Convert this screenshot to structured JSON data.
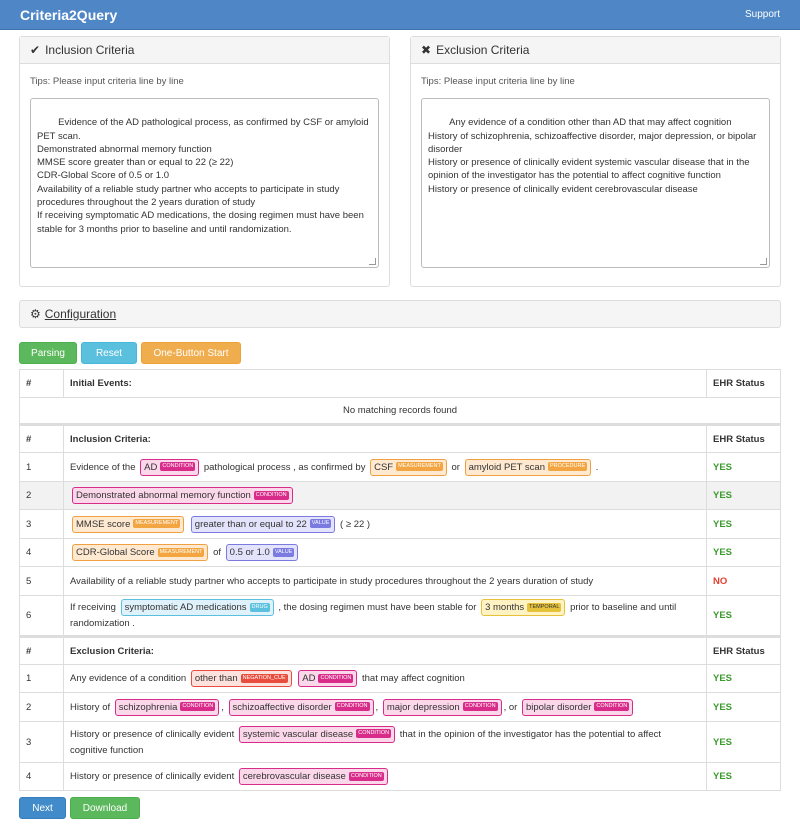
{
  "nav": {
    "brand": "Criteria2Query",
    "support": "Support"
  },
  "inclusion_panel": {
    "title": "Inclusion Criteria",
    "tips": "Tips: Please input criteria line by line",
    "text": "Evidence of the AD pathological process, as confirmed by CSF or amyloid PET scan.\nDemonstrated abnormal memory function\nMMSE score greater than or equal to 22 (≥ 22)\nCDR-Global Score of 0.5 or 1.0\nAvailability of a reliable study partner who accepts to participate in study procedures throughout the 2 years duration of study\nIf receiving symptomatic AD medications, the dosing regimen must have been stable for 3 months prior to baseline and until randomization."
  },
  "exclusion_panel": {
    "title": "Exclusion Criteria",
    "tips": "Tips: Please input criteria line by line",
    "text": "Any evidence of a condition other than AD that may affect cognition\nHistory of schizophrenia, schizoaffective disorder, major depression, or bipolar disorder\nHistory or presence of clinically evident systemic vascular disease that in the opinion of the investigator has the potential to affect cognitive function\nHistory or presence of clinically evident cerebrovascular disease"
  },
  "config": {
    "label": "Configuration"
  },
  "buttons": {
    "parsing": "Parsing",
    "reset": "Reset",
    "one_button": "One-Button Start",
    "next": "Next",
    "download": "Download"
  },
  "tags": {
    "condition": "CONDITION",
    "measurement": "MEASUREMENT",
    "procedure": "PROCEDURE",
    "value": "VALUE",
    "drug": "DRUG",
    "temporal": "TEMPORAL",
    "negation": "NEGATION_CUE"
  },
  "table": {
    "hash": "#",
    "ehr": "EHR Status",
    "initial_header": "Initial Events:",
    "no_records": "No matching records found",
    "inclusion_header": "Inclusion Criteria:",
    "exclusion_header": "Exclusion Criteria:",
    "inc": [
      {
        "n": "1",
        "status": "YES",
        "parts": [
          "Evidence of the",
          "AD",
          "pathological process , as confirmed by",
          "CSF",
          "or",
          "amyloid PET scan",
          "."
        ]
      },
      {
        "n": "2",
        "status": "YES",
        "parts": [
          "Demonstrated abnormal memory function"
        ]
      },
      {
        "n": "3",
        "status": "YES",
        "parts": [
          "MMSE score",
          "greater than or equal to 22",
          "( ≥ 22 )"
        ]
      },
      {
        "n": "4",
        "status": "YES",
        "parts": [
          "CDR-Global Score",
          "of",
          "0.5 or 1.0"
        ]
      },
      {
        "n": "5",
        "status": "NO",
        "parts": [
          "Availability of a reliable study partner who accepts to participate in study procedures throughout the 2 years duration of study"
        ]
      },
      {
        "n": "6",
        "status": "YES",
        "parts": [
          "If receiving",
          "symptomatic AD medications",
          ", the dosing regimen must have been stable for",
          "3 months",
          "prior to baseline and until randomization ."
        ]
      }
    ],
    "exc": [
      {
        "n": "1",
        "status": "YES",
        "parts": [
          "Any evidence of a condition",
          "other than",
          "AD",
          "that may affect cognition"
        ]
      },
      {
        "n": "2",
        "status": "YES",
        "parts": [
          "History of",
          "schizophrenia",
          ",",
          "schizoaffective disorder",
          ",",
          "major depression",
          ", or",
          "bipolar disorder"
        ]
      },
      {
        "n": "3",
        "status": "YES",
        "parts": [
          "History or presence of clinically evident",
          "systemic vascular disease",
          "that in the opinion of the investigator has the potential to affect cognitive function"
        ]
      },
      {
        "n": "4",
        "status": "YES",
        "parts": [
          "History or presence of clinically evident",
          "cerebrovascular disease"
        ]
      }
    ]
  },
  "colors": {
    "navbar": "#4e86c6",
    "yes": "#3c9a2e",
    "no": "#e53d2e",
    "condition": "#d92c8a"
  }
}
